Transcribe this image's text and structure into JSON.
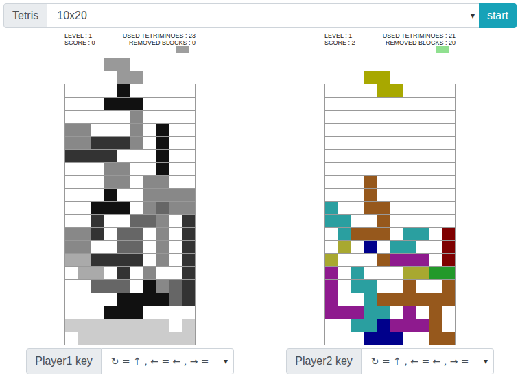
{
  "toolbar": {
    "label": "Tetris",
    "select": {
      "value": "10x20",
      "arrow": "▾"
    },
    "button": "start"
  },
  "players": [
    {
      "level": "LEVEL : 1",
      "used": "USED TETRIMINOES : 23",
      "score": "SCORE : 0",
      "removed": "REMOVED BLOCKS : 0",
      "next": {
        "color": "#9e9e9e"
      },
      "falling": {
        "color": "#999999",
        "cells": [
          [
            -2,
            3
          ],
          [
            -2,
            4
          ],
          [
            -1,
            4
          ],
          [
            -1,
            5
          ]
        ]
      },
      "board": {
        "palette": {
          "k": "#111111",
          "d": "#333333",
          "m": "#666666",
          "g": "#888888",
          "l": "#aaaaaa",
          "p": "#cccccc"
        },
        "rows": [
          "....k.....",
          "...kkk....",
          ".....g....",
          "gg...g.k..",
          "ggdddg.k..",
          "dddd...k..",
          "...gg..k..",
          "...gg.gg..",
          "...k..gggg",
          "..kkk.gmgg",
          "..d..mmg.d",
          "ggd.mm.g.d",
          "gg..mm.g.d",
          "lldddd.g.d",
          ".ll.d.g..d",
          "..mmm.kgmd",
          "....kkkkmd",
          "...kkk....",
          "pppppppp.p",
          ".ppppppppp"
        ]
      },
      "key_label": "Player1 key",
      "key_select": {
        "value": "↻ = ↑ , ← = ← , → =",
        "arrow": "▾"
      }
    },
    {
      "level": "LEVEL : 1",
      "used": "USED TETRIMINOES : 21",
      "score": "SCORE : 2",
      "removed": "REMOVED BLOCKS : 20",
      "next": {
        "color": "#90e090"
      },
      "falling": {
        "color": "#a8a800",
        "cells": [
          [
            -1,
            3
          ],
          [
            -1,
            4
          ],
          [
            0,
            4
          ],
          [
            0,
            5
          ]
        ]
      },
      "board": {
        "palette": {
          "t": "#2a9fa0",
          "b": "#96581c",
          "u": "#8e1a8e",
          "o": "#a8a830",
          "n": "#00008b",
          "r": "#7f0000",
          "e": "#22992a"
        },
        "rows": [
          "..........",
          "..........",
          "..........",
          "..........",
          "..........",
          "..........",
          "..........",
          "...b......",
          "...b......",
          "t..bb.....",
          "tt..b.....",
          ".tbbb.tt.r",
          ".o.n.tt..r",
          "o...buuu.r",
          "u.t...ooee",
          "u.tt..b..b",
          "u..tbbbbbb",
          "uuutt.u.b.",
          "..ttnuuub.",
          "...nnn..bb"
        ]
      },
      "key_label": "Player2 key",
      "key_select": {
        "value": "↻ = ↑ , ← = ← , → =",
        "arrow": "▾"
      }
    }
  ]
}
